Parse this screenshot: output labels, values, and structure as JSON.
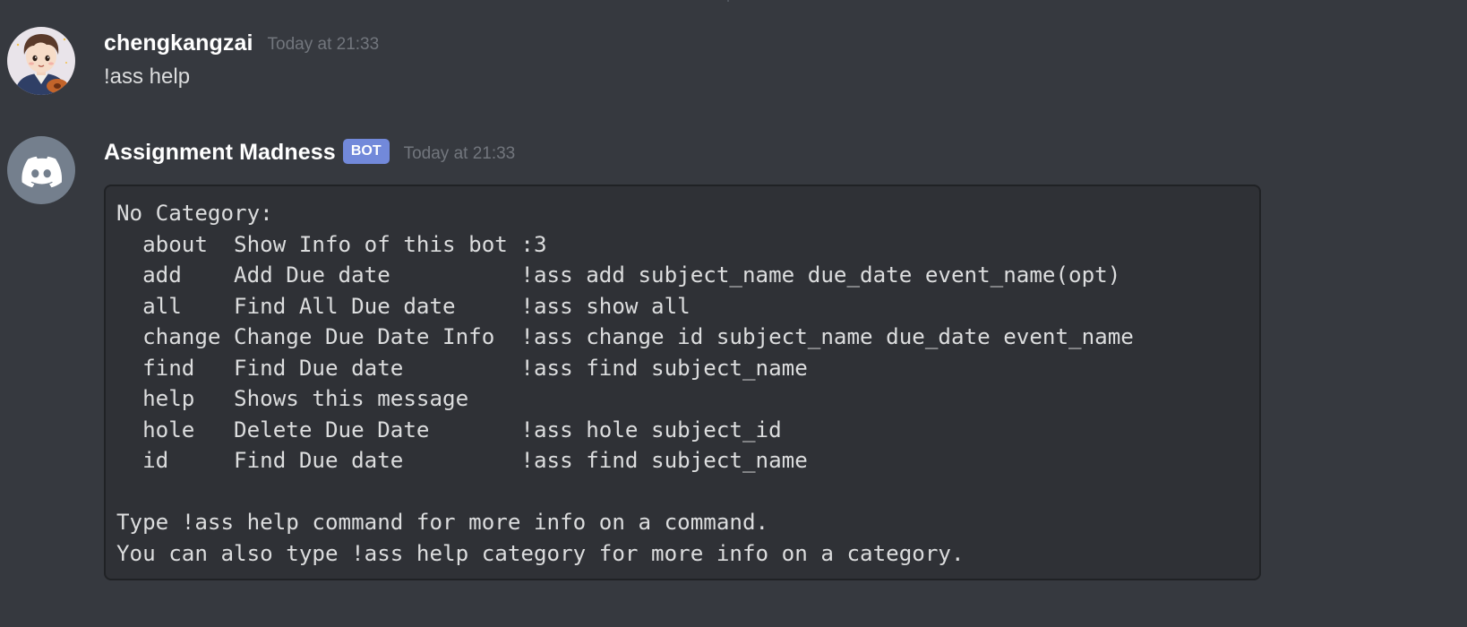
{
  "messages": [
    {
      "username": "chengkangzai",
      "timestamp": "Today at 21:33",
      "content": "!ass help",
      "avatar_icon": "user-avatar-cartoon"
    },
    {
      "username": "Assignment Madness",
      "badge": "BOT",
      "timestamp": "Today at 21:33",
      "avatar_icon": "discord-logo-icon",
      "code": "No Category:\n  about  Show Info of this bot :3\n  add    Add Due date          !ass add subject_name due_date event_name(opt)\n  all    Find All Due date     !ass show all\n  change Change Due Date Info  !ass change id subject_name due_date event_name\n  find   Find Due date         !ass find subject_name\n  help   Shows this message\n  hole   Delete Due Date       !ass hole subject_id\n  id     Find Due date         !ass find subject_name\n\nType !ass help command for more info on a command.\nYou can also type !ass help category for more info on a category."
    }
  ],
  "colors": {
    "background": "#36393f",
    "codeblock_bg": "#2f3136",
    "username": "#ffffff",
    "text": "#dcddde",
    "timestamp": "#72767d",
    "bot_badge": "#7289da",
    "discord_avatar_bg": "#747f8d"
  }
}
